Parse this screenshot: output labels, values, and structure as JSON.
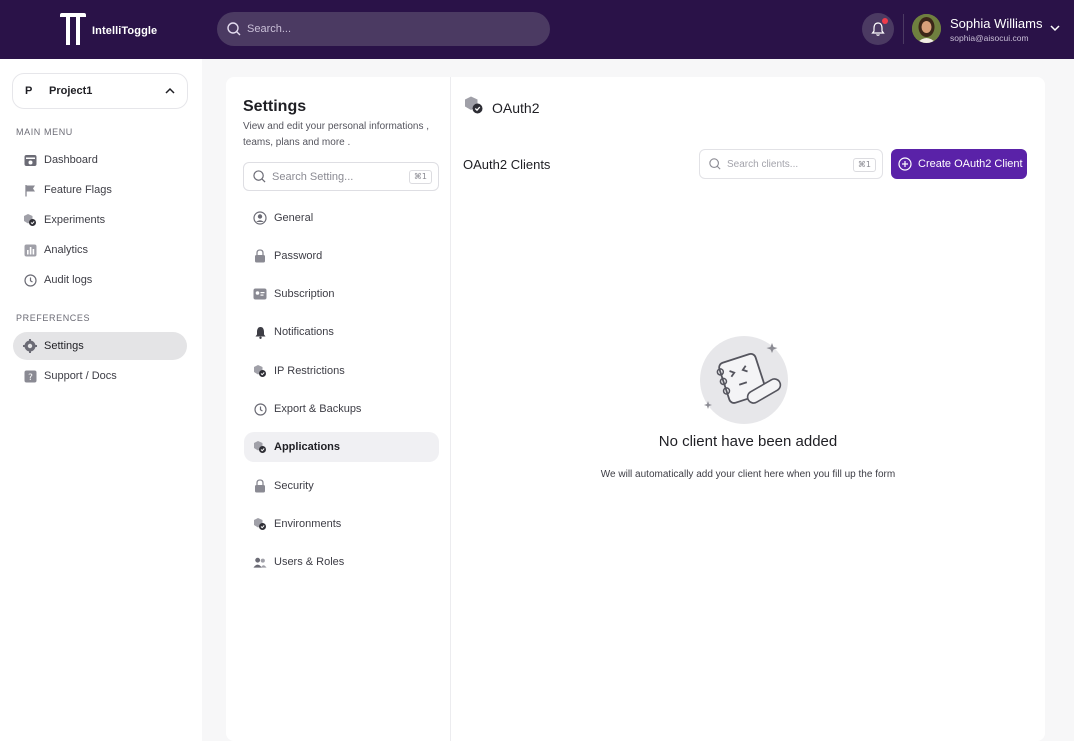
{
  "app": {
    "name": "IntelliToggle"
  },
  "topbar": {
    "search_placeholder": "Search...",
    "user": {
      "name": "Sophia Williams",
      "email": "sophia@aisocui.com"
    }
  },
  "sidebar": {
    "project": {
      "badge": "P",
      "name": "Project1"
    },
    "main_menu_label": "MAIN MENU",
    "main_menu": [
      {
        "label": "Dashboard",
        "icon": "dashboard-icon"
      },
      {
        "label": "Feature Flags",
        "icon": "flag-icon"
      },
      {
        "label": "Experiments",
        "icon": "experiment-icon"
      },
      {
        "label": "Analytics",
        "icon": "analytics-icon"
      },
      {
        "label": "Audit logs",
        "icon": "clock-icon"
      }
    ],
    "preferences_label": "PREFERENCES",
    "preferences": [
      {
        "label": "Settings",
        "icon": "gear-icon",
        "active": true
      },
      {
        "label": "Support / Docs",
        "icon": "help-icon"
      }
    ]
  },
  "settings": {
    "title": "Settings",
    "subtitle": "View and edit your personal informations , teams, plans and more .",
    "search_placeholder": "Search Setting...",
    "search_shortcut": "⌘1",
    "items": [
      {
        "label": "General"
      },
      {
        "label": "Password"
      },
      {
        "label": "Subscription"
      },
      {
        "label": "Notifications"
      },
      {
        "label": "IP Restrictions"
      },
      {
        "label": "Export & Backups"
      },
      {
        "label": "Applications",
        "active": true
      },
      {
        "label": "Security"
      },
      {
        "label": "Environments"
      },
      {
        "label": "Users & Roles"
      }
    ]
  },
  "oauth": {
    "title": "OAuth2",
    "clients_title": "OAuth2 Clients",
    "search_placeholder": "Search clients...",
    "search_shortcut": "⌘1",
    "create_button": "Create OAuth2 Client",
    "empty_title": "No client have been added",
    "empty_subtitle": "We will automatically add your client here when you fill up the form"
  },
  "colors": {
    "topbar": "#2a1248",
    "accent": "#5a22a8"
  }
}
